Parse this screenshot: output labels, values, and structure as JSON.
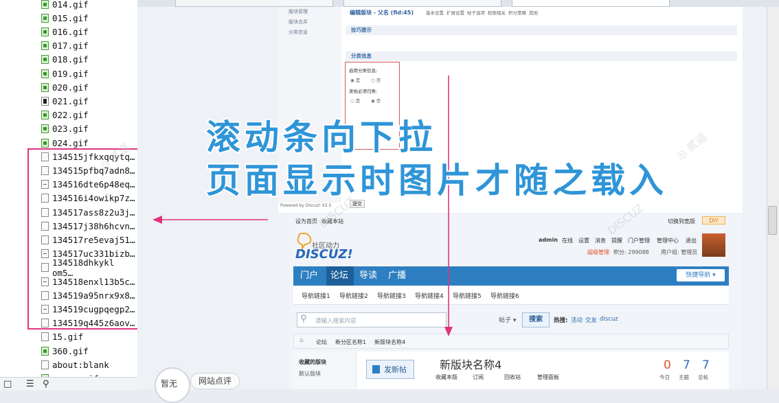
{
  "file_list": [
    {
      "name": "014.gif",
      "icon": "gif-icon"
    },
    {
      "name": "015.gif",
      "icon": "gif-icon"
    },
    {
      "name": "016.gif",
      "icon": "gif-icon"
    },
    {
      "name": "017.gif",
      "icon": "gif-icon"
    },
    {
      "name": "018.gif",
      "icon": "gif-icon"
    },
    {
      "name": "019.gif",
      "icon": "gif-icon"
    },
    {
      "name": "020.gif",
      "icon": "gif-icon"
    },
    {
      "name": "021.gif",
      "icon": "dark-file-icon"
    },
    {
      "name": "022.gif",
      "icon": "gif-icon"
    },
    {
      "name": "023.gif",
      "icon": "gif-icon"
    },
    {
      "name": "024.gif",
      "icon": "gif-icon"
    },
    {
      "name": "134515jfkxqqytq…",
      "icon": "blank-file-icon"
    },
    {
      "name": "134515pfbq7adn8…",
      "icon": "blank-file-icon"
    },
    {
      "name": "134516dte6p48eq…",
      "icon": "mini-file-icon"
    },
    {
      "name": "134516i4owikp7z…",
      "icon": "blank-file-icon"
    },
    {
      "name": "134517ass8z2u3j…",
      "icon": "blank-file-icon"
    },
    {
      "name": "134517j38h6hcvn…",
      "icon": "blank-file-icon"
    },
    {
      "name": "134517re5evaj51…",
      "icon": "blank-file-icon"
    },
    {
      "name": "134517uc331bizb…",
      "icon": "mini-file-icon"
    },
    {
      "name": "134518dhkykl om5…",
      "icon": "blank-file-icon"
    },
    {
      "name": "134518enxl13b5c…",
      "icon": "mini-file-icon"
    },
    {
      "name": "134519a95nrx9x8…",
      "icon": "blank-file-icon"
    },
    {
      "name": "134519cugpqegp2…",
      "icon": "mini-file-icon"
    },
    {
      "name": "134519q445z6aov…",
      "icon": "blank-file-icon"
    },
    {
      "name": "15.gif",
      "icon": "blank-file-icon"
    },
    {
      "name": "360.gif",
      "icon": "gif-icon"
    },
    {
      "name": "about:blank",
      "icon": "blank-file-icon"
    },
    {
      "name": "agree.gif",
      "icon": "gif-icon"
    }
  ],
  "caption": {
    "line1": "滚动条向下拉",
    "line2": "页面显示时图片才随之载入"
  },
  "bottom": {
    "circle_label": "暂无",
    "review_button": "网站点评"
  },
  "admin": {
    "breadcrumb": "编辑版块 - 父名 (fid:45)",
    "tabs": [
      "基本设置",
      "扩展设置",
      "帖子选项",
      "权限相关",
      "积分策略",
      "其他"
    ],
    "side_links": [
      "版块管理",
      "版块合并",
      "分类信息"
    ],
    "section_tips": "技巧提示",
    "section_category": "分类信息",
    "option_enable": "启用分类信息:",
    "option_yes": "是",
    "option_no": "否",
    "option_required": "发帖必须归类:",
    "submit": "提交",
    "powered": "Powered by Discuz! X2.5"
  },
  "forum": {
    "top_links": [
      "设为首页",
      "收藏本站"
    ],
    "switch_style": "切换到宽版",
    "diy": "DIY",
    "site_slogan": "社区动力",
    "logo_text": "DISCUZ!",
    "user": "admin",
    "user_menu": [
      "在线",
      "设置",
      "消息",
      "提醒",
      "门户管理",
      "管理中心",
      "退出"
    ],
    "user_group": "超级管理",
    "points": "积分: 299088",
    "user_group_label": "用户组: 管理员",
    "nav": [
      "门户",
      "论坛",
      "导读",
      "广播"
    ],
    "quick_nav": "快捷导航",
    "subnav": [
      "导航链接1",
      "导航链接2",
      "导航链接3",
      "导航链接4",
      "导航链接5",
      "导航链接6"
    ],
    "search_placeholder": "请输入搜索内容",
    "search_scope": "帖子",
    "search_button": "搜索",
    "hot_label": "热搜:",
    "hot_terms": [
      "活动",
      "交友",
      "discuz"
    ],
    "breadcrumb": [
      "论坛",
      "新分区名称1",
      "新版块名称4"
    ],
    "sidebar_title": "收藏的版块",
    "sidebar_item": "默认版块",
    "post_button": "发新帖",
    "board_title": "新版块名称4",
    "board_actions": [
      "收藏本版",
      "订阅",
      "回收站",
      "管理面板"
    ],
    "stats": [
      {
        "value": "0",
        "label": "今日"
      },
      {
        "value": "7",
        "label": "主题"
      },
      {
        "value": "7",
        "label": "总帖"
      }
    ]
  },
  "colors": {
    "highlight": "#e1347f",
    "caption": "#2f95d8",
    "nav": "#2e7fc1"
  }
}
